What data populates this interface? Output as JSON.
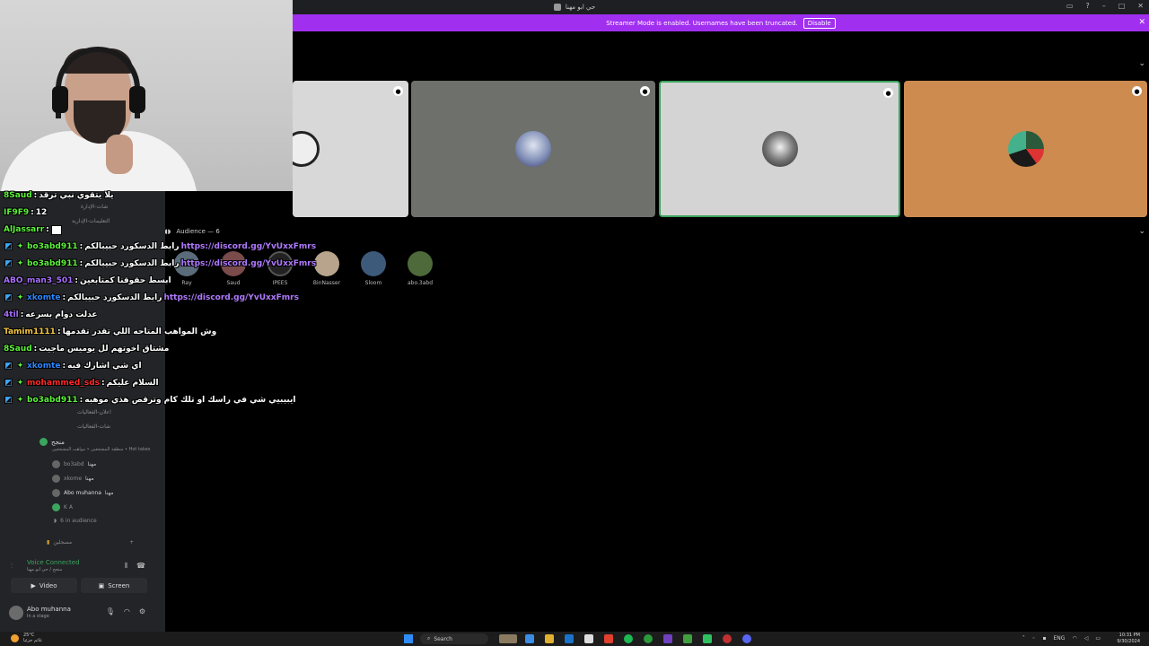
{
  "window": {
    "title": "حي ابو مهنا"
  },
  "banner": {
    "message": "Streamer Mode is enabled. Usernames have been truncated.",
    "disable_label": "Disable"
  },
  "audience": {
    "header": "Audience — 6",
    "members": [
      "Ray",
      "Saud",
      "IPEES",
      "BinNasser",
      "Sloom",
      "abo.3abd"
    ]
  },
  "sidebar": {
    "channels": [
      "شات-الإدارة",
      "التعليمات-الإدارية",
      "اعلان-الفعاليات",
      "شات-الفعاليات"
    ],
    "stage": {
      "name": "منجح",
      "topic": "منطقة المشجعين • مواهب المشجعين • Hot takes"
    },
    "speakers": [
      "bo3abd",
      "xkome",
      "Abo muhanna",
      "K A"
    ],
    "speaker_badge": "مهنا",
    "audience_count": "6 in audience",
    "category": "مسجلين"
  },
  "voice": {
    "title": "Voice Connected",
    "subtitle": "منجح / حي ابو مهنا",
    "video_label": "Video",
    "screen_label": "Screen"
  },
  "user": {
    "name": "Abo muhanna",
    "status": "In a stage"
  },
  "chat": [
    {
      "platform": "kick",
      "user": "8Saud",
      "color": "#5cf23b",
      "text": "يلا يتقوي نبي ترقد",
      "link": ""
    },
    {
      "platform": "kick",
      "user": "IF9F9",
      "color": "#5cf23b",
      "text": "12",
      "link": ""
    },
    {
      "platform": "kick",
      "user": "AlJassarr",
      "color": "#5cf23b",
      "text": "",
      "link": ""
    },
    {
      "platform": "twitch",
      "user": "bo3abd911",
      "color": "#5cf23b",
      "text": "رابط الدسكورد حبيبالكم",
      "link": "https://discord.gg/YvUxxFmrs"
    },
    {
      "platform": "twitch",
      "user": "bo3abd911",
      "color": "#5cf23b",
      "text": "رابط الدسكورد حبيبالكم",
      "link": "https://discord.gg/YvUxxFmrs"
    },
    {
      "platform": "kick",
      "user": "ABO_man3_501",
      "color": "#a970ff",
      "text": "ابسط حقوقنا كمتابعين",
      "link": ""
    },
    {
      "platform": "twitch",
      "user": "xkomte",
      "color": "#2b88ff",
      "text": "رابط الدسكورد حبيبالكم",
      "link": "https://discord.gg/YvUxxFmrs"
    },
    {
      "platform": "kick",
      "user": "4til",
      "color": "#a970ff",
      "text": "عدلت دوام بسرعه",
      "link": ""
    },
    {
      "platform": "kick",
      "user": "Tamim1111",
      "color": "#f5c842",
      "text": "وش المواهب المتاحه اللي تقدر تقدمها",
      "link": ""
    },
    {
      "platform": "kick",
      "user": "8Saud",
      "color": "#5cf23b",
      "text": "مشتاق اخوتهم لل يوميس ماجيت",
      "link": ""
    },
    {
      "platform": "twitch",
      "user": "xkomte",
      "color": "#2b88ff",
      "text": "اي شي اشارك فيه",
      "link": ""
    },
    {
      "platform": "twitch",
      "user": "mohammed_sds",
      "color": "#ff2a2a",
      "text": "السلام عليكم",
      "link": ""
    },
    {
      "platform": "twitch",
      "user": "bo3abd911",
      "color": "#5cf23b",
      "text": "ايبيبيي شي في راسك او تلك كام وترقص هذي موهبه",
      "link": ""
    }
  ],
  "taskbar": {
    "weather_temp": "25°C",
    "weather_desc": "غائم جزئيا",
    "search_label": "Search",
    "lang": "ENG",
    "time": "10:31 PM",
    "date": "9/30/2024"
  },
  "colors": {
    "banner": "#a12ff0",
    "voice_green": "#3ba55d",
    "link": "#b07aff"
  }
}
